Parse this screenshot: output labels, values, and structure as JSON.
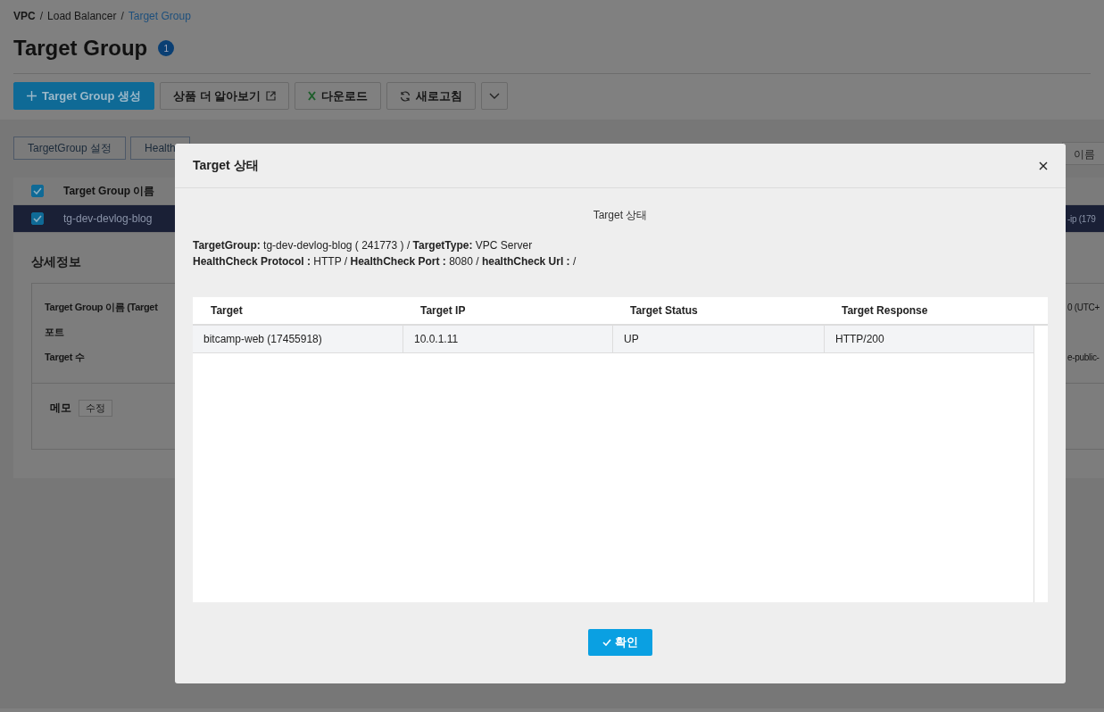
{
  "breadcrumb": [
    {
      "label": "VPC",
      "current": false
    },
    {
      "label": "Load Balancer",
      "current": false
    },
    {
      "label": "Target Group",
      "current": true
    }
  ],
  "breadcrumb_separator": "/",
  "page": {
    "title": "Target Group",
    "count": "1"
  },
  "toolbar": [
    {
      "kind": "primary",
      "label": "Target Group 생성"
    },
    {
      "kind": "external",
      "label": "상품 더 알아보기"
    },
    {
      "kind": "excel",
      "label": "다운로드"
    },
    {
      "kind": "refresh",
      "label": "새로고침"
    },
    {
      "kind": "menu"
    }
  ],
  "action_tabs": [
    "TargetGroup 설정",
    "Health"
  ],
  "filter_fragment": "이름",
  "list": {
    "header": {
      "label": "Target Group 이름",
      "checked": true
    },
    "rows": [
      {
        "name": "tg-dev-devlog-blog",
        "checked": true,
        "selected": true,
        "column_fragment": "-ip (179"
      }
    ]
  },
  "details": {
    "title": "상세정보",
    "fields": [
      {
        "label": "Target Group 이름 (Target",
        "fragment": "0 (UTC+"
      },
      {
        "label": "포트"
      },
      {
        "label": "Target 수",
        "fragment": "e-public-"
      }
    ],
    "memo_label": "메모",
    "memo_edit": "수정"
  },
  "modal": {
    "title": "Target 상태",
    "caption": "Target 상태",
    "info": [
      "**TargetGroup:** tg-dev-devlog-blog ( 241773 ) / **TargetType:** VPC Server",
      "**HealthCheck Protocol :** HTTP / **HealthCheck Port :** 8080 / **healthCheck Url :** /"
    ],
    "columns": [
      "Target",
      "Target IP",
      "Target Status",
      "Target Response"
    ],
    "rows": [
      [
        "bitcamp-web (17455918)",
        "10.0.1.11",
        "UP",
        "HTTP/200"
      ]
    ],
    "confirm": "확인"
  }
}
